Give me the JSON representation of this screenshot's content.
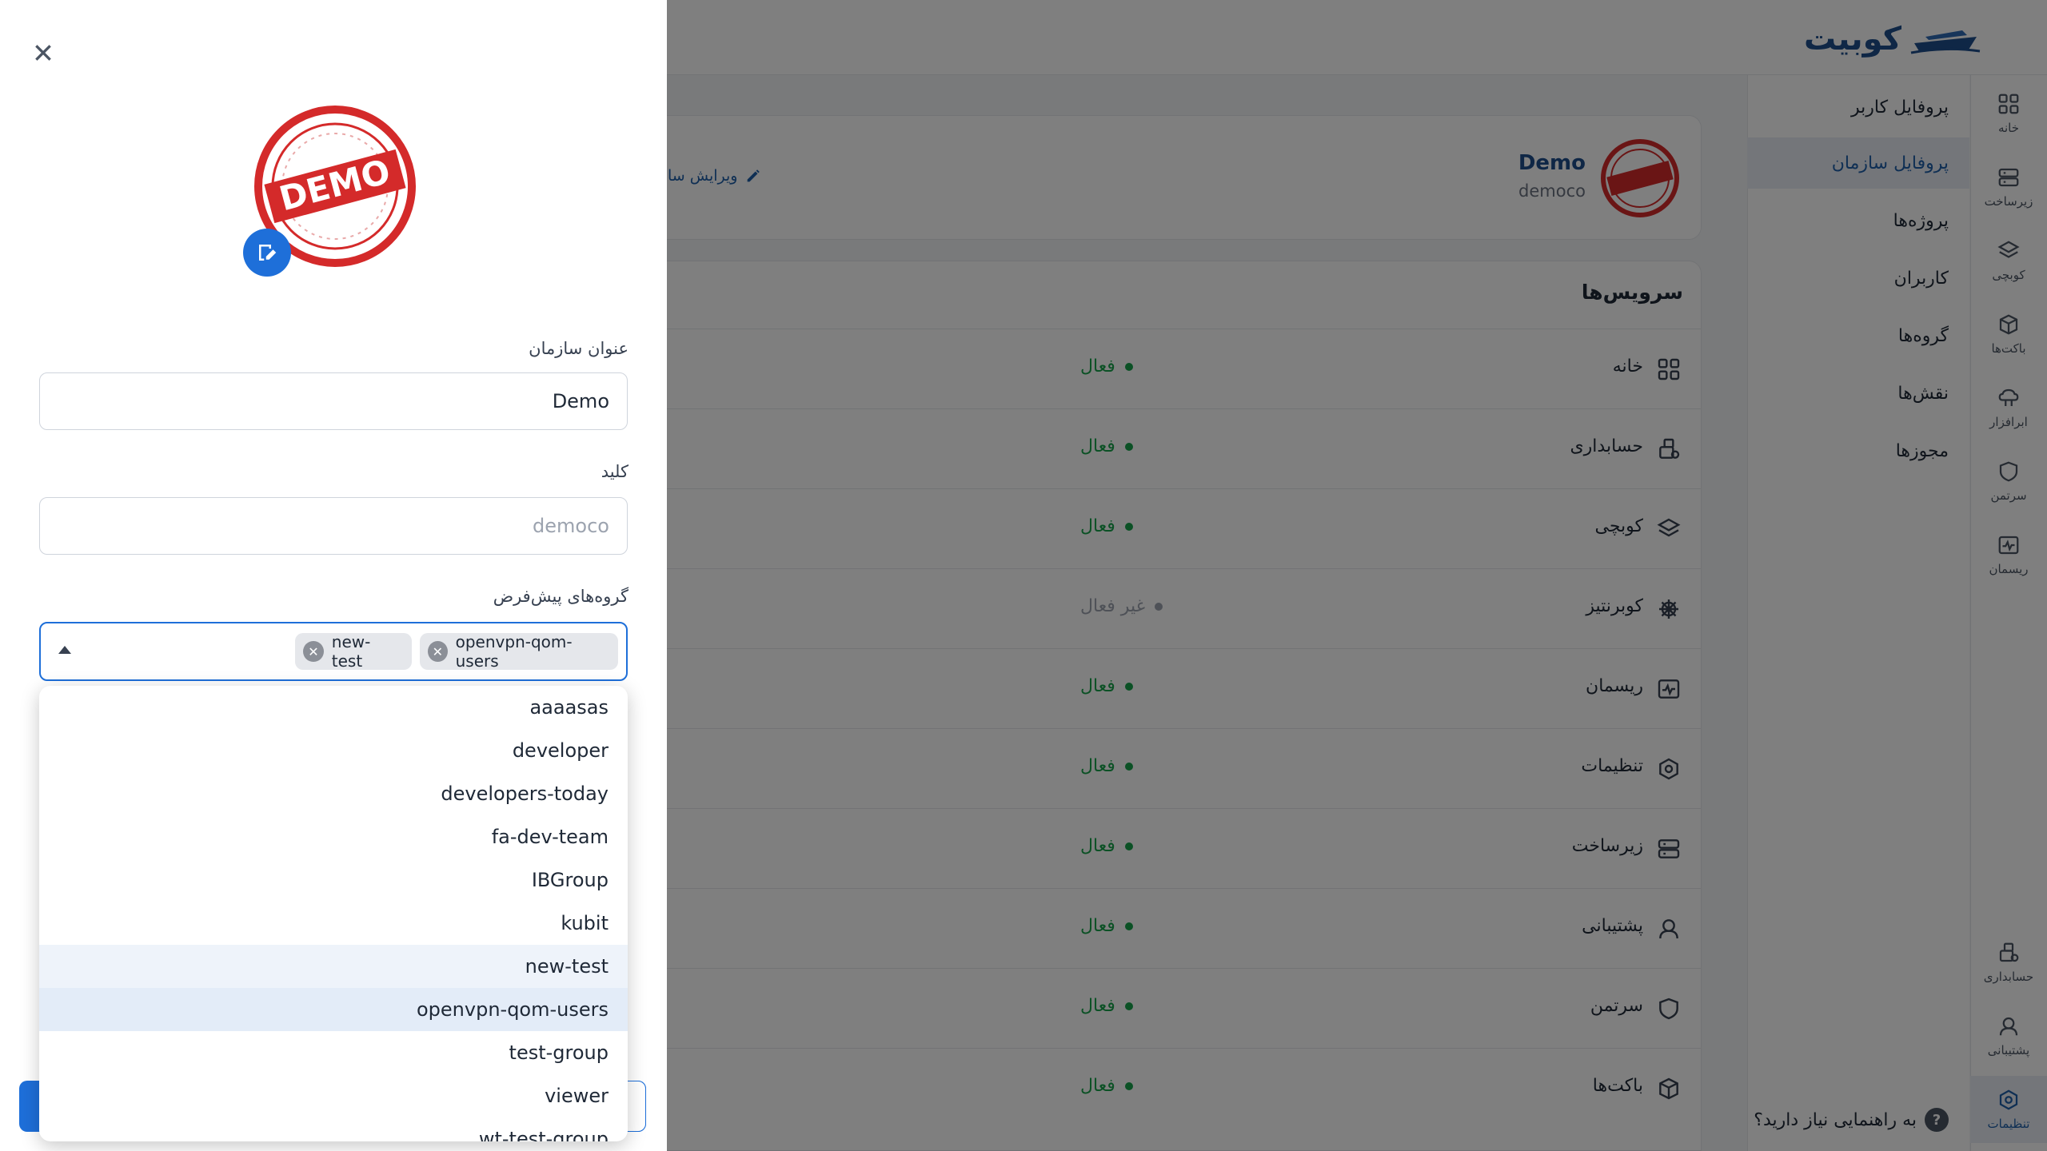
{
  "brand": {
    "name": "کوبیت"
  },
  "rail": {
    "top": [
      {
        "label": "خانه",
        "icon": "grid-icon"
      },
      {
        "label": "زیرساخت",
        "icon": "server-icon"
      },
      {
        "label": "کوبچی",
        "icon": "layers-icon"
      },
      {
        "label": "باکت‌ها",
        "icon": "box-icon"
      },
      {
        "label": "ابرافزار",
        "icon": "cloud-app-icon"
      },
      {
        "label": "سرتمن",
        "icon": "shield-icon"
      },
      {
        "label": "ریسمان",
        "icon": "pulse-icon"
      }
    ],
    "bottom": [
      {
        "label": "حسابداری",
        "icon": "accounting-icon"
      },
      {
        "label": "پشتیبانی",
        "icon": "support-icon"
      },
      {
        "label": "تنظیمات",
        "icon": "settings-icon"
      }
    ]
  },
  "submenu": {
    "items": [
      "پروفایل کاربر",
      "پروفایل سازمان",
      "پروژه‌ها",
      "کاربران",
      "گروه‌ها",
      "نقش‌ها",
      "مجوزها"
    ],
    "help": "به راهنمایی نیاز دارید؟"
  },
  "org": {
    "name": "Demo",
    "key": "democo",
    "edit_label": "ویرایش سا"
  },
  "services": {
    "title": "سرویس‌ها",
    "rows": [
      {
        "name": "خانه",
        "status": "فعال",
        "active": true
      },
      {
        "name": "حسابداری",
        "status": "فعال",
        "active": true
      },
      {
        "name": "کوبچی",
        "status": "فعال",
        "active": true
      },
      {
        "name": "کوبرنتیز",
        "status": "غیر فعال",
        "active": false
      },
      {
        "name": "ریسمان",
        "status": "فعال",
        "active": true
      },
      {
        "name": "تنظیمات",
        "status": "فعال",
        "active": true
      },
      {
        "name": "زیرساخت",
        "status": "فعال",
        "active": true
      },
      {
        "name": "پشتیبانی",
        "status": "فعال",
        "active": true
      },
      {
        "name": "سرتمن",
        "status": "فعال",
        "active": true
      },
      {
        "name": "باکت‌ها",
        "status": "فعال",
        "active": true
      }
    ]
  },
  "drawer": {
    "avatar_text": "DEMO",
    "title_label": "عنوان سازمان",
    "title_value": "Demo",
    "key_label": "کلید",
    "key_value": "democo",
    "groups_label": "گروه‌های پیش‌فرض",
    "chips": [
      "openvpn-qom-users",
      "new-test"
    ],
    "options": [
      "aaaasas",
      "developer",
      "developers-today",
      "fa-dev-team",
      "IBGroup",
      "kubit",
      "new-test",
      "openvpn-qom-users",
      "test-group",
      "viewer",
      "wt-test-group"
    ]
  },
  "colors": {
    "accent": "#1e6fd9",
    "brand": "#1e4e8c",
    "active": "#16a34a",
    "inactive": "#9ca3af"
  }
}
